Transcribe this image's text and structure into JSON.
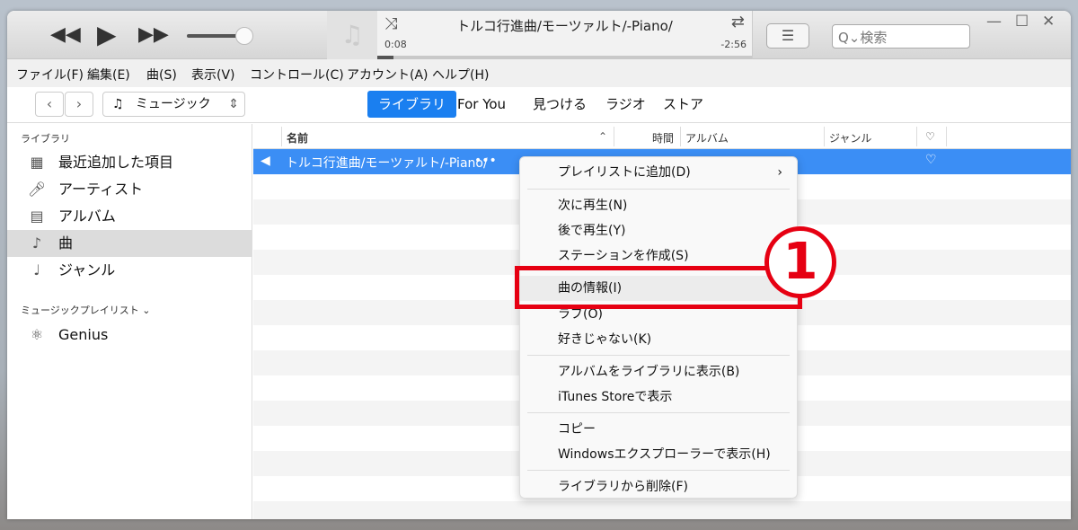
{
  "player": {
    "title": "トルコ行進曲/モーツァルト/-Piano/",
    "elapsed": "0:08",
    "remaining": "-2:56",
    "progress_percent": 4.3,
    "volume_percent": 85
  },
  "search": {
    "placeholder": "検索"
  },
  "menubar": [
    "ファイル(F)",
    "編集(E)",
    "曲(S)",
    "表示(V)",
    "コントロール(C)",
    "アカウント(A)",
    "ヘルプ(H)"
  ],
  "nav": {
    "media": "ミュージック",
    "tabs": [
      "ライブラリ",
      "For You",
      "見つける",
      "ラジオ",
      "ストア"
    ],
    "active_tab": "ライブラリ"
  },
  "sidebar": {
    "library_header": "ライブラリ",
    "items": [
      {
        "label": "最近追加した項目",
        "icon": "calendar-icon"
      },
      {
        "label": "アーティスト",
        "icon": "microphone-icon"
      },
      {
        "label": "アルバム",
        "icon": "album-icon"
      },
      {
        "label": "曲",
        "icon": "note-icon"
      },
      {
        "label": "ジャンル",
        "icon": "genre-icon"
      }
    ],
    "active": "曲",
    "playlist_header": "ミュージックプレイリスト ⌄",
    "playlists": [
      {
        "label": "Genius",
        "icon": "atom-icon"
      }
    ]
  },
  "table": {
    "columns": [
      "名前",
      "時間",
      "アルバム",
      "ジャンル",
      "♡"
    ],
    "rows": [
      {
        "name": "トルコ行進曲/モーツァルト/-Piano/",
        "more": "•••"
      }
    ]
  },
  "context_menu": {
    "items": [
      "プレイリストに追加(D)",
      "次に再生(N)",
      "後で再生(Y)",
      "ステーションを作成(S)",
      "曲の情報(I)",
      "ラブ(O)",
      "好きじゃない(K)",
      "アルバムをライブラリに表示(B)",
      "iTunes Storeで表示",
      "コピー",
      "Windowsエクスプローラーで表示(H)",
      "ライブラリから削除(F)"
    ]
  },
  "annotation": {
    "number": "1",
    "color": "#e60012"
  },
  "colors": {
    "accent": "#1a7ff0",
    "selection": "#3b8ef5"
  }
}
